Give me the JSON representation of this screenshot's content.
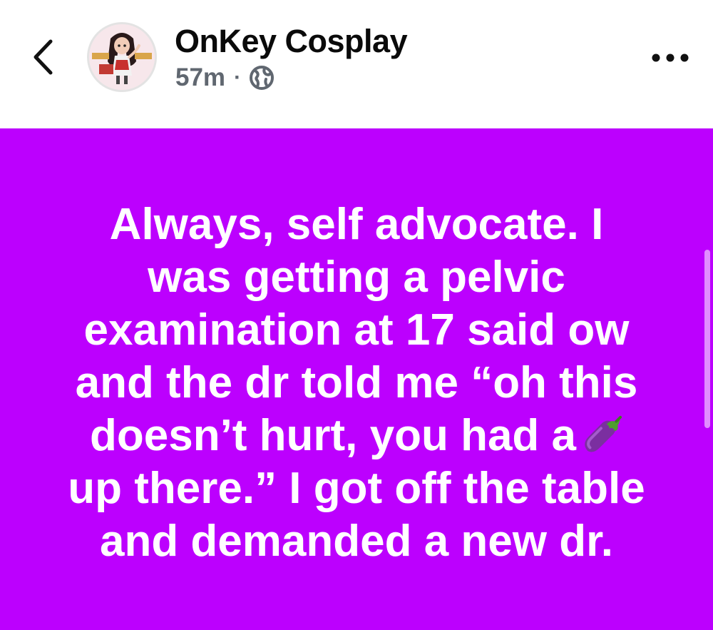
{
  "header": {
    "back_icon": "chevron-left-icon",
    "page_name": "OnKey Cosplay",
    "time": "57m",
    "separator": "·",
    "audience_icon": "globe-icon",
    "more_icon": "more-horizontal-icon"
  },
  "post": {
    "background_color": "#bc00fe",
    "text_color": "#ffffff",
    "lines": [
      "Always, self advocate. I",
      "was getting a pelvic",
      "examination at 17 said ow",
      "and the dr told me “oh this",
      "doesn’t hurt, you had a",
      "up there.” I got off the table",
      "and demanded a new dr."
    ],
    "emoji": "eggplant-emoji"
  }
}
